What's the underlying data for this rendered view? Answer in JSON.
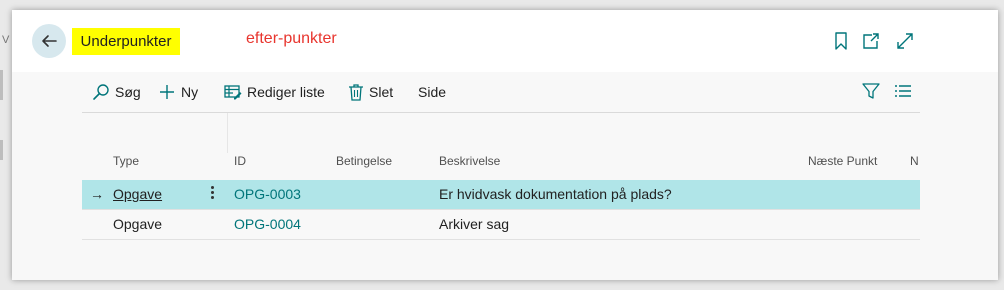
{
  "page": {
    "title": "Underpunkter",
    "annotation": "efter-punkter",
    "background_title_glyph": "V",
    "colors": {
      "highlight": "#ffff00",
      "annotation": "#e8352e",
      "selected_row": "#b0e5e8",
      "link": "#00757a",
      "icon": "#00757a",
      "back_button": "#d7e8ee"
    }
  },
  "header": {
    "icons": [
      "back-arrow-icon",
      "bookmark-icon",
      "share-icon",
      "expand-icon"
    ]
  },
  "toolbar": {
    "search_label": "Søg",
    "new_label": "Ny",
    "edit_list_label": "Rediger liste",
    "delete_label": "Slet",
    "page_label": "Side",
    "icons": [
      "search-icon",
      "plus-icon",
      "edit-list-icon",
      "trash-icon",
      "filter-icon",
      "list-view-icon"
    ]
  },
  "grid": {
    "columns": {
      "type": "Type",
      "id": "ID",
      "condition": "Betingelse",
      "description": "Beskrivelse",
      "next_point": "Næste Punkt",
      "truncated": "N"
    },
    "rows": [
      {
        "type": "Opgave",
        "id": "OPG-0003",
        "condition": "",
        "description": "Er hvidvask dokumentation på plads?",
        "next_point": "",
        "selected": true
      },
      {
        "type": "Opgave",
        "id": "OPG-0004",
        "condition": "",
        "description": "Arkiver sag",
        "next_point": "",
        "selected": false
      }
    ]
  }
}
